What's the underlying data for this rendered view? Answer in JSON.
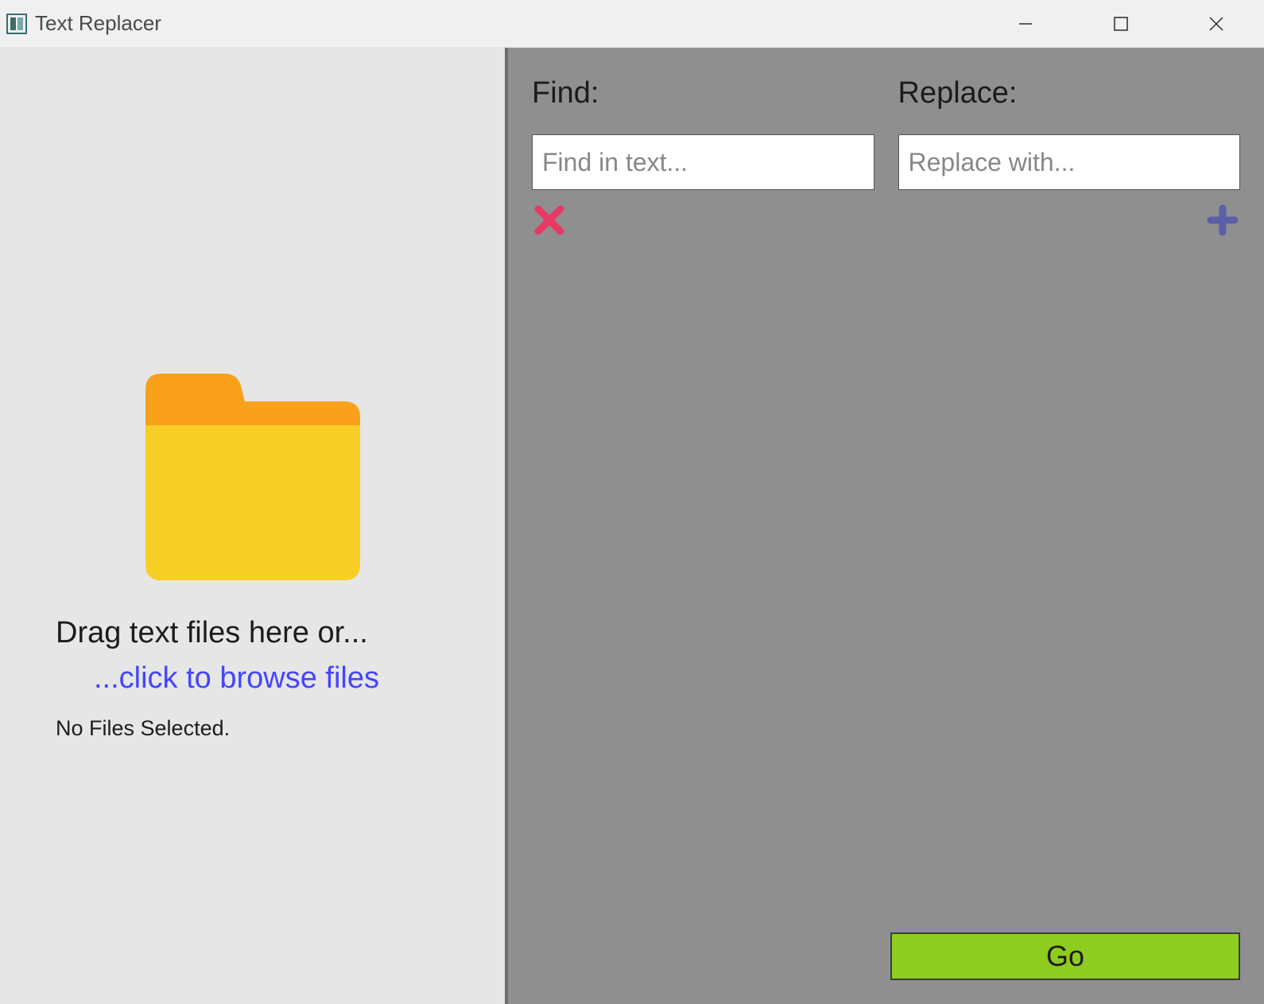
{
  "window": {
    "title": "Text Replacer"
  },
  "left_panel": {
    "drag_text": "Drag text files here or...",
    "browse_text": "...click to browse files",
    "status_text": "No Files Selected."
  },
  "right_panel": {
    "find_label": "Find:",
    "replace_label": "Replace:",
    "find_placeholder": "Find in text...",
    "replace_placeholder": "Replace with...",
    "find_value": "",
    "replace_value": "",
    "go_label": "Go"
  },
  "icons": {
    "app": "app-icon",
    "minimize": "minimize-icon",
    "maximize": "maximize-icon",
    "close": "close-icon",
    "folder": "folder-icon",
    "remove_row": "x-icon",
    "add_row": "plus-icon"
  },
  "colors": {
    "left_bg": "#e6e6e6",
    "right_bg": "#8f8f8f",
    "link": "#4545ff",
    "go_bg": "#8ecd1f",
    "remove": "#e73964",
    "add": "#5a5fa6",
    "folder_top": "#f9a11b",
    "folder_body": "#f8cf26"
  }
}
